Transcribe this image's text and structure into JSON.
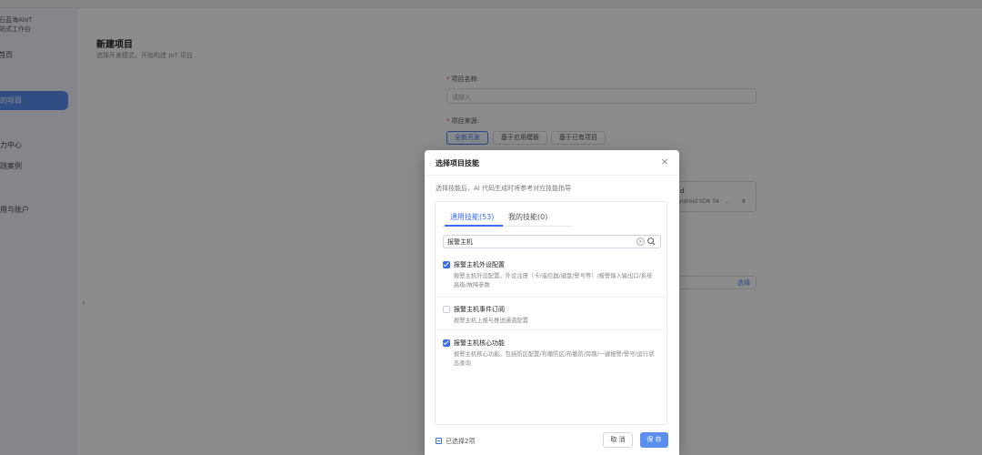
{
  "sidebar": {
    "brand_line1": "鲸石蓝海AIoT",
    "brand_line2": "一站式工作台",
    "items": [
      {
        "label": "首页"
      },
      {
        "label": "我的项目"
      },
      {
        "label": "能力中心"
      },
      {
        "label": "实践案例"
      },
      {
        "label": "费用与账户"
      }
    ],
    "collapse_glyph": "‹"
  },
  "page": {
    "title": "新建项目",
    "subtitle": "选择开发模式，开始构建 IoT 项目",
    "name_label": "项目名称:",
    "name_placeholder": "请输入",
    "source_label": "项目来源:",
    "source_options": [
      {
        "label": "全新开发",
        "selected": true
      },
      {
        "label": "基于应用模板",
        "selected": false
      },
      {
        "label": "基于已有项目",
        "selected": false
      }
    ],
    "env_card_text_1": "d",
    "env_card_text_2": "· Android SDK 34 · ...",
    "env_card_text_3": "8",
    "pick_label": "选择"
  },
  "modal": {
    "title": "选择项目技能",
    "close_glyph": "×",
    "description": "选择技能后，AI 代码生成时将参考对应技能指导",
    "tabs": [
      {
        "label": "通用技能(53)",
        "active": true
      },
      {
        "label": "我的技能(0)",
        "active": false
      }
    ],
    "search": {
      "value": "报警主机",
      "clear_glyph": "×"
    },
    "skills": [
      {
        "name": "报警主机外设配置",
        "checked": true,
        "description": "报警主机外设配置。外设注册（卡/遥控器/键盘/警号等）/报警输入输出口/系统高级/故障参数"
      },
      {
        "name": "报警主机事件订阅",
        "checked": false,
        "description": "报警主机上报与推送通道配置"
      },
      {
        "name": "报警主机核心功能",
        "checked": true,
        "description": "报警主机核心功能。包括防区配置/布撤防区/布撤防/旁路/一键报警/警号/运行状态查询"
      }
    ],
    "footer": {
      "selected_count": "已选择2项",
      "cancel_label": "取 消",
      "save_label": "保 存"
    }
  },
  "colors": {
    "accent": "#3b6df0",
    "primary_button": "#5a8ff0",
    "overlay": "rgba(0,0,0,0.45)"
  }
}
